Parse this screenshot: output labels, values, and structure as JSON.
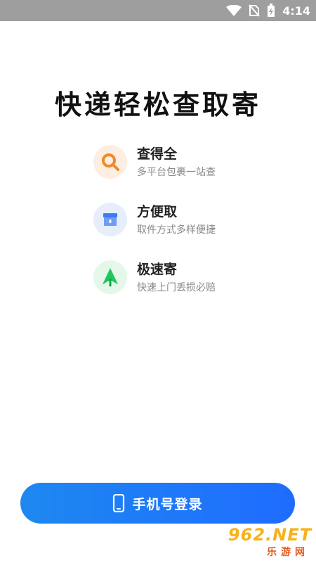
{
  "status_bar": {
    "time": "4:14"
  },
  "title": "快递轻松查取寄",
  "features": [
    {
      "title": "查得全",
      "desc": "多平台包裹一站查",
      "icon": "search-icon"
    },
    {
      "title": "方便取",
      "desc": "取件方式多样便捷",
      "icon": "locker-icon"
    },
    {
      "title": "极速寄",
      "desc": "快速上门丢损必赔",
      "icon": "rocket-icon"
    }
  ],
  "login_button": {
    "label": "手机号登录",
    "icon": "phone-icon"
  },
  "watermark": {
    "top": "962.NET",
    "bottom": "乐游网"
  },
  "colors": {
    "accent": "#1f6cff",
    "search": "#f08a2a",
    "locker": "#3b7bf0",
    "rocket": "#22c55e"
  }
}
